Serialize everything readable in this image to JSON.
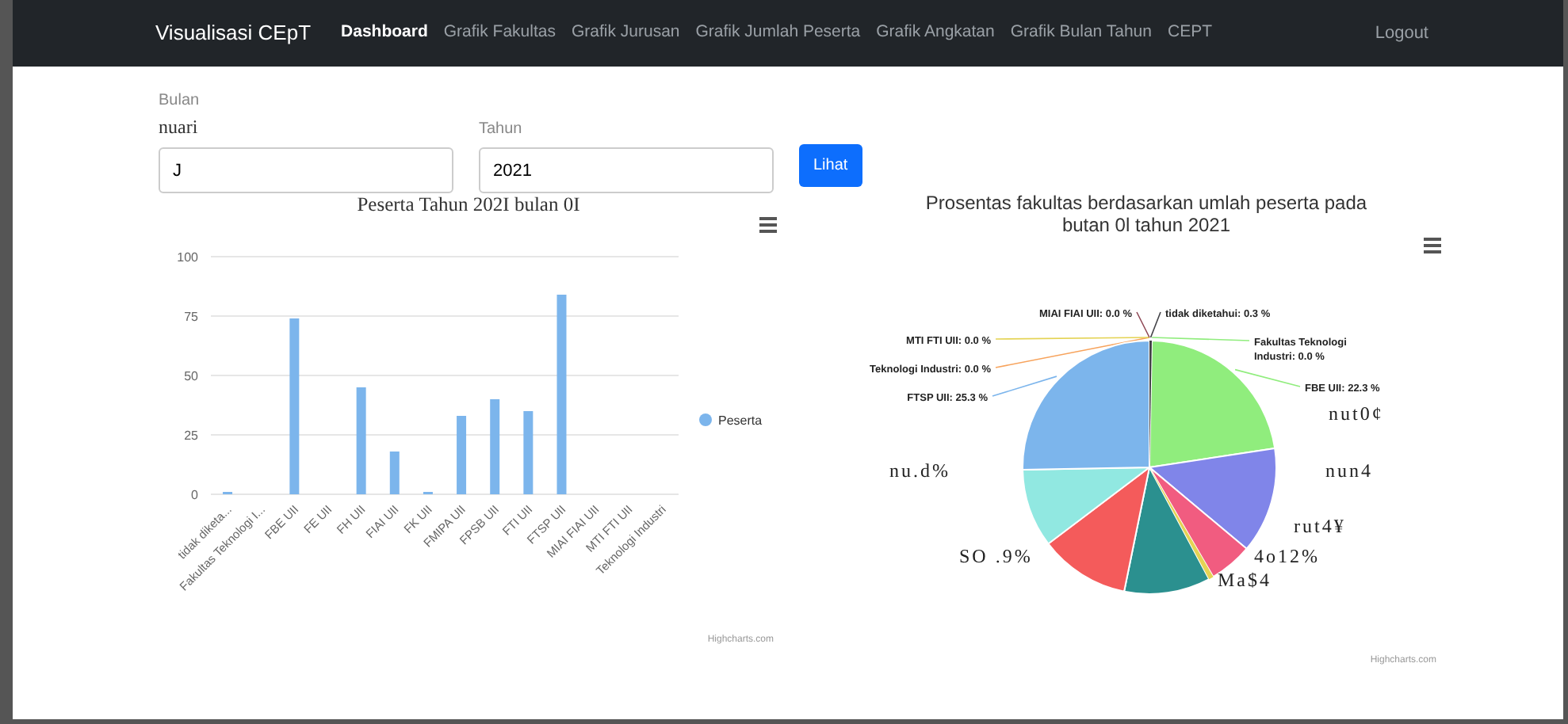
{
  "navbar": {
    "brand": "Visualisasi CEpT",
    "links": [
      {
        "label": "Dashboard",
        "selected": true
      },
      {
        "label": "Grafik Fakultas",
        "selected": false
      },
      {
        "label": "Grafik Jurusan",
        "selected": false
      },
      {
        "label": "Grafik Jumlah Peserta",
        "selected": false
      },
      {
        "label": "Grafik Angkatan",
        "selected": false
      },
      {
        "label": "Grafik Bulan Tahun",
        "selected": false
      },
      {
        "label": "CEPT",
        "selected": false
      }
    ],
    "logout": "Logout"
  },
  "form": {
    "heading": "Bulan",
    "month_label": "nuari",
    "month_value": "J",
    "year_label": "Tahun",
    "year_value": "2021",
    "submit": "Lihat"
  },
  "bar_chart": {
    "menu": true,
    "credits": "Highcharts.com",
    "chart_data": {
      "type": "bar",
      "title": "Peserta Tahun 202I bulan 0I",
      "categories": [
        "tidak diketa...",
        "Fakultas Teknologi I...",
        "FBE UII",
        "FE UII",
        "FH UII",
        "FIAI UII",
        "FK UII",
        "FMIPA UII",
        "FPSB UII",
        "FTI UII",
        "FTSP UII",
        "MIAI FIAI UII",
        "MTI FTI UII",
        "Teknologi Industri"
      ],
      "ylim": [
        0,
        100
      ],
      "yticks": [
        0,
        25,
        50,
        75,
        100
      ],
      "grid": true,
      "series": [
        {
          "name": "Peserta",
          "color": "#7cb5ec",
          "values": [
            1,
            0,
            74,
            0,
            45,
            18,
            1,
            33,
            40,
            35,
            84,
            0,
            0,
            0
          ]
        }
      ]
    }
  },
  "pie_chart": {
    "menu": true,
    "credits": "Highcharts.com",
    "overlay_labels": [
      "nut0¢",
      "nun4",
      "rut4¥",
      "4o12%",
      "Ma$4",
      "SO .9%",
      "nu.d%"
    ],
    "chart_data": {
      "type": "pie",
      "title": "Prosentas fakultas berdasarkan umlah peserta pada butan 0l tahun 2021",
      "categories": [
        "tidak diketahui: 0.3 %",
        "Fakultas Teknologi Industri: 0.0 %",
        "FBE UII: 22.3 %",
        null,
        null,
        null,
        null,
        null,
        null,
        "FTSP UII: 25.3 %",
        "Teknologi Industri: 0.0 %",
        "MTI FTI UII: 0.0 %",
        "MIAI FIAI UII: 0.0 %"
      ],
      "colors": [
        "#434348",
        "#90ed7d",
        "#90ed7d",
        "#8085e9",
        "#f15c80",
        "#e4d354",
        "#2b908f",
        "#f45b5b",
        "#91e8e1",
        "#7cb5ec",
        "#f7a35c",
        "#e4d354",
        "#8d4653"
      ],
      "values": [
        0.3,
        0,
        22.3,
        13.5,
        5.5,
        0.6,
        11,
        11.5,
        10,
        25.3,
        0,
        0,
        0
      ]
    }
  }
}
